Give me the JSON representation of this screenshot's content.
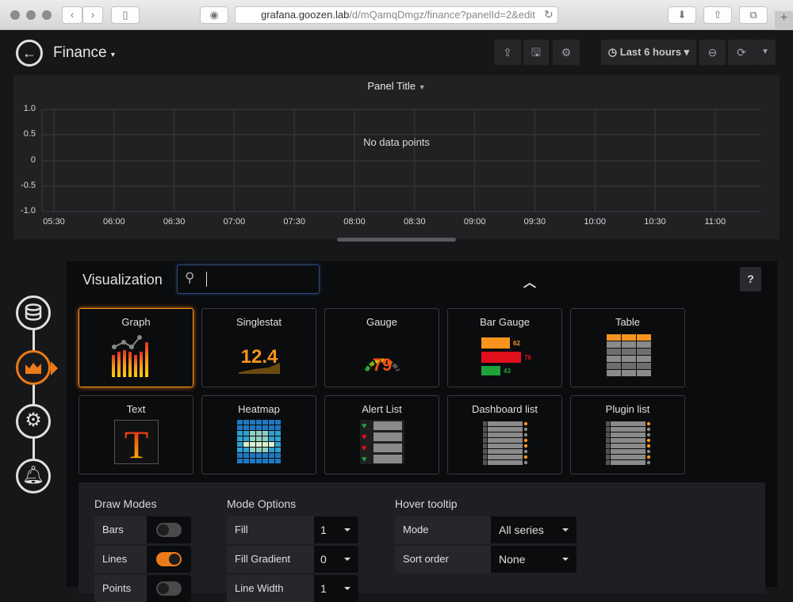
{
  "browser": {
    "url_host": "grafana.goozen.lab",
    "url_path": "/d/mQamqDmgz/finance?panelId=2&edit"
  },
  "navbar": {
    "dashboard_title": "Finance",
    "time_range": "Last 6 hours"
  },
  "panel": {
    "title": "Panel Title",
    "empty_message": "No data points",
    "y_ticks": [
      "1.0",
      "0.5",
      "0",
      "-0.5",
      "-1.0"
    ],
    "x_ticks": [
      "05:30",
      "06:00",
      "06:30",
      "07:00",
      "07:30",
      "08:00",
      "08:30",
      "09:00",
      "09:30",
      "10:00",
      "10:30",
      "11:00"
    ]
  },
  "editor": {
    "section_title": "Visualization",
    "search_value": "",
    "help_label": "?",
    "sidebar": [
      "queries",
      "visualization",
      "general",
      "alert"
    ],
    "visualizations": [
      {
        "label": "Graph",
        "selected": true
      },
      {
        "label": "Singlestat",
        "sample": "12.4"
      },
      {
        "label": "Gauge",
        "sample": "79"
      },
      {
        "label": "Bar Gauge",
        "samples": [
          "62",
          "76",
          "43"
        ]
      },
      {
        "label": "Table"
      },
      {
        "label": "Text",
        "sample": "T"
      },
      {
        "label": "Heatmap"
      },
      {
        "label": "Alert List"
      },
      {
        "label": "Dashboard list"
      },
      {
        "label": "Plugin list"
      }
    ]
  },
  "options": {
    "draw_modes": {
      "title": "Draw Modes",
      "items": [
        {
          "label": "Bars",
          "on": false
        },
        {
          "label": "Lines",
          "on": true
        },
        {
          "label": "Points",
          "on": false
        }
      ]
    },
    "mode_options": {
      "title": "Mode Options",
      "items": [
        {
          "label": "Fill",
          "value": "1"
        },
        {
          "label": "Fill Gradient",
          "value": "0"
        },
        {
          "label": "Line Width",
          "value": "1"
        }
      ]
    },
    "hover_tooltip": {
      "title": "Hover tooltip",
      "items": [
        {
          "label": "Mode",
          "value": "All series"
        },
        {
          "label": "Sort order",
          "value": "None"
        }
      ]
    }
  },
  "colors": {
    "accent": "#eb7b18",
    "background": "#161719"
  }
}
